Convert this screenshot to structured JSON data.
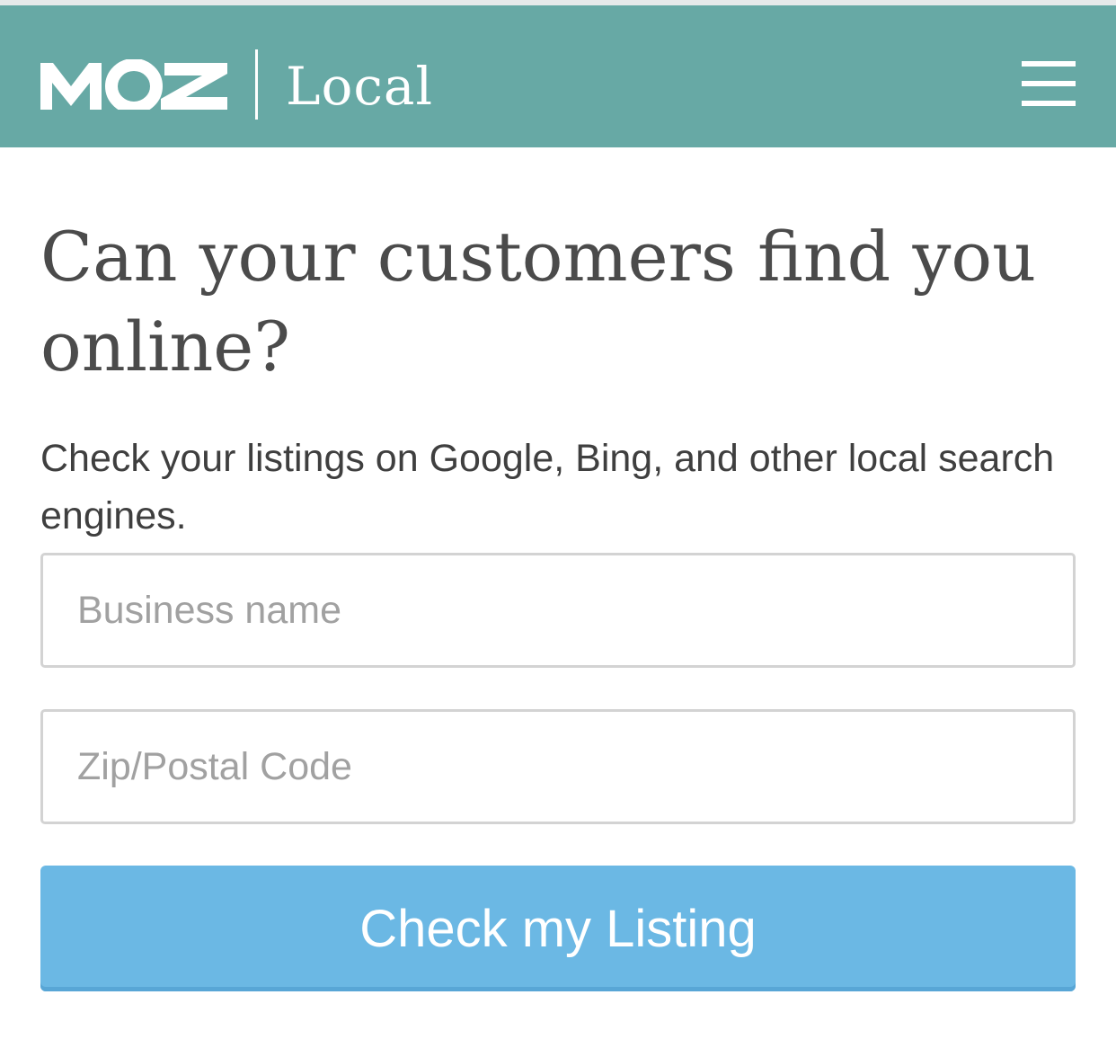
{
  "header": {
    "logo_text": "MOZ",
    "product_name": "Local",
    "background_color": "#67a9a5",
    "menu_icon": "hamburger-menu-icon"
  },
  "hero": {
    "headline": "Can your customers find you online?",
    "subtext": "Check your listings on Google, Bing, and other local search engines."
  },
  "form": {
    "business_name_placeholder": "Business name",
    "business_name_value": "",
    "zip_placeholder": "Zip/Postal Code",
    "zip_value": "",
    "submit_label": "Check my Listing",
    "submit_color": "#6bb8e4"
  }
}
